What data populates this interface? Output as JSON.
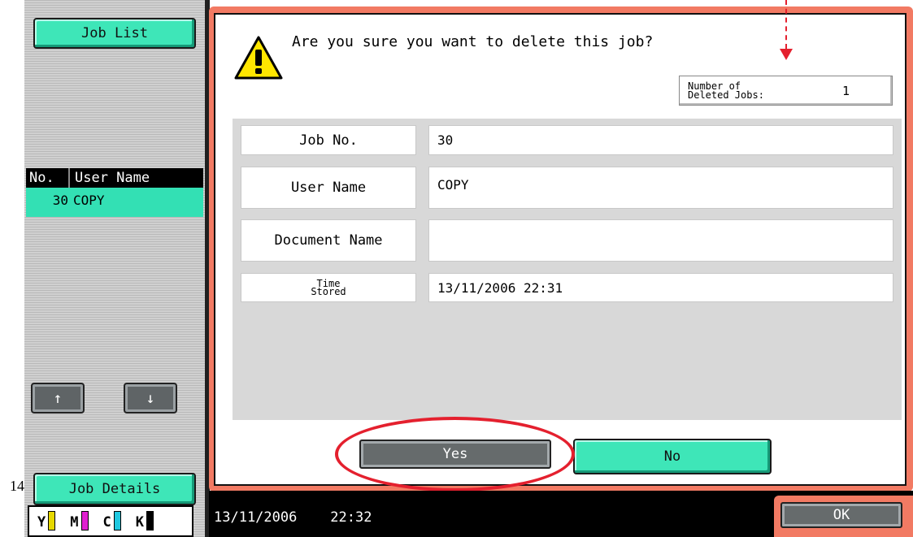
{
  "sidebar": {
    "job_list_label": "Job List",
    "table_header": {
      "no": "No.",
      "user_name": "User Name"
    },
    "rows": [
      {
        "no": "30",
        "user": "COPY"
      }
    ],
    "up_arrow": "↑",
    "down_arrow": "↓",
    "job_details_label": "Job Details",
    "page_number": "14",
    "toner": [
      {
        "letter": "Y",
        "color": "#e6d800"
      },
      {
        "letter": "M",
        "color": "#e020d0"
      },
      {
        "letter": "C",
        "color": "#20c8e0"
      },
      {
        "letter": "K",
        "color": "#000000"
      }
    ]
  },
  "dialog": {
    "question": "Are you sure you want to delete this job?",
    "deleted_jobs_label_line1": "Number of",
    "deleted_jobs_label_line2": "Deleted Jobs:",
    "deleted_jobs_count": "1",
    "fields": {
      "job_no_label": "Job No.",
      "job_no_value": "30",
      "user_name_label": "User Name",
      "user_name_value": "COPY",
      "document_name_label": "Document Name",
      "document_name_value": "",
      "time_stored_label_line1": "Time",
      "time_stored_label_line2": "Stored",
      "time_stored_value": "13/11/2006  22:31"
    },
    "yes_label": "Yes",
    "no_label": "No"
  },
  "status_bar": {
    "datetime": "13/11/2006    22:32",
    "ok_label": "OK"
  },
  "colors": {
    "teal_button": "#3ee6b8",
    "dialog_frame": "#f27a63",
    "annotation_red": "#e4202e"
  }
}
